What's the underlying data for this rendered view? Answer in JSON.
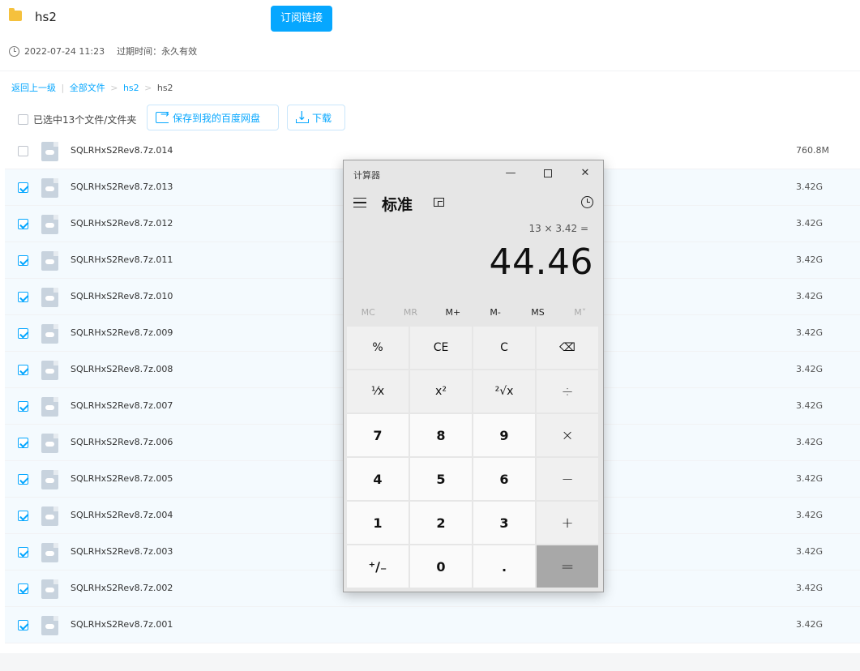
{
  "header": {
    "folder_name": "hs2",
    "subscribe_label": "订阅链接",
    "created": "2022-07-24 11:23",
    "expire": "过期时间：永久有效"
  },
  "breadcrumb": {
    "back": "返回上一级",
    "divider": "|",
    "all_files": "全部文件",
    "sep": ">",
    "parent": "hs2",
    "current": "hs2"
  },
  "toolbar": {
    "select_all_label": "已选中13个文件/文件夹",
    "save_label": "保存到我的百度网盘",
    "download_label": "下载"
  },
  "files": [
    {
      "name": "SQLRHxS2Rev8.7z.014",
      "size": "760.8M",
      "selected": false
    },
    {
      "name": "SQLRHxS2Rev8.7z.013",
      "size": "3.42G",
      "selected": true
    },
    {
      "name": "SQLRHxS2Rev8.7z.012",
      "size": "3.42G",
      "selected": true
    },
    {
      "name": "SQLRHxS2Rev8.7z.011",
      "size": "3.42G",
      "selected": true
    },
    {
      "name": "SQLRHxS2Rev8.7z.010",
      "size": "3.42G",
      "selected": true
    },
    {
      "name": "SQLRHxS2Rev8.7z.009",
      "size": "3.42G",
      "selected": true
    },
    {
      "name": "SQLRHxS2Rev8.7z.008",
      "size": "3.42G",
      "selected": true
    },
    {
      "name": "SQLRHxS2Rev8.7z.007",
      "size": "3.42G",
      "selected": true
    },
    {
      "name": "SQLRHxS2Rev8.7z.006",
      "size": "3.42G",
      "selected": true
    },
    {
      "name": "SQLRHxS2Rev8.7z.005",
      "size": "3.42G",
      "selected": true
    },
    {
      "name": "SQLRHxS2Rev8.7z.004",
      "size": "3.42G",
      "selected": true
    },
    {
      "name": "SQLRHxS2Rev8.7z.003",
      "size": "3.42G",
      "selected": true
    },
    {
      "name": "SQLRHxS2Rev8.7z.002",
      "size": "3.42G",
      "selected": true
    },
    {
      "name": "SQLRHxS2Rev8.7z.001",
      "size": "3.42G",
      "selected": true
    }
  ],
  "calculator": {
    "window_title": "计算器",
    "mode": "标准",
    "expression": "13 × 3.42 =",
    "result": "44.46",
    "memory": [
      {
        "label": "MC",
        "enabled": false
      },
      {
        "label": "MR",
        "enabled": false
      },
      {
        "label": "M+",
        "enabled": true
      },
      {
        "label": "M-",
        "enabled": true
      },
      {
        "label": "MS",
        "enabled": true
      },
      {
        "label": "M˅",
        "enabled": false
      }
    ],
    "keys": {
      "percent": "%",
      "ce": "CE",
      "clear": "C",
      "backspace": "⌫",
      "reciprocal": "⅟x",
      "square": "x²",
      "sqrt": "²√x",
      "divide": "÷",
      "seven": "7",
      "eight": "8",
      "nine": "9",
      "multiply": "×",
      "four": "4",
      "five": "5",
      "six": "6",
      "minus": "−",
      "one": "1",
      "two": "2",
      "three": "3",
      "plus": "+",
      "negate": "⁺∕₋",
      "zero": "0",
      "decimal": ".",
      "equals": "="
    }
  },
  "colors": {
    "accent": "#06a7ff",
    "selected_row": "#f4fafe",
    "equals_key": "#a8a8a8"
  }
}
